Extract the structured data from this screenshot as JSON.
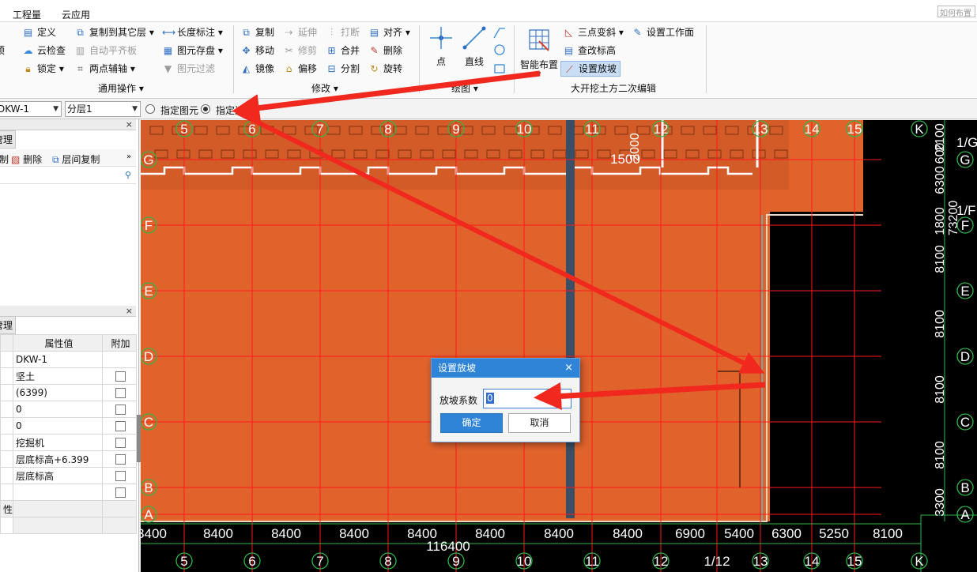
{
  "menu": {
    "items": [
      "工程量",
      "云应用"
    ],
    "help_placeholder": "如何布置"
  },
  "ribbon": {
    "common": {
      "items": [
        "定义",
        "云检查",
        "锁定",
        "复制到其它层",
        "自动平齐板",
        "两点辅轴",
        "长度标注",
        "图元存盘",
        "图元过滤"
      ],
      "group_label": "通用操作"
    },
    "modify": {
      "items": [
        "复制",
        "延伸",
        "打断",
        "对齐",
        "移动",
        "修剪",
        "合并",
        "删除",
        "镜像",
        "偏移",
        "分割",
        "旋转"
      ],
      "group_label": "修改"
    },
    "draw": {
      "items": [
        "点",
        "直线"
      ],
      "group_label": "绘图"
    },
    "pit": {
      "big_label": "智能布置",
      "items": [
        "三点变斜",
        "设置工作面",
        "查改标高",
        "设置放坡"
      ],
      "group_label": "大开挖土方二次编辑"
    },
    "left_cut": "顶"
  },
  "propbar": {
    "element": "DKW-1",
    "layer": "分层1",
    "radio1": "指定图元",
    "radio2": "指定边"
  },
  "left_panel": {
    "top_tab": "管理",
    "tools": [
      "删除",
      "层间复制"
    ],
    "prop_tab": "管理",
    "headers": [
      "属性值",
      "附加"
    ],
    "rows": [
      {
        "value": "DKW-1",
        "check": false
      },
      {
        "value": "坚土",
        "check": true
      },
      {
        "value": "(6399)",
        "check": true
      },
      {
        "value": "0",
        "check": true
      },
      {
        "value": "0",
        "check": true
      },
      {
        "value": "挖掘机",
        "check": true
      },
      {
        "value": "层底标高+6.399",
        "check": true
      },
      {
        "value": "层底标高",
        "check": true
      },
      {
        "value": "",
        "check": true
      },
      {
        "value": "",
        "check": false
      },
      {
        "value": "",
        "check": false
      }
    ],
    "attr_cut": "性"
  },
  "canvas": {
    "col_labels": [
      "5",
      "6",
      "7",
      "8",
      "9",
      "10",
      "11",
      "12",
      "13",
      "14",
      "15"
    ],
    "bottom_col_labels": [
      "5",
      "6",
      "7",
      "8",
      "9",
      "10",
      "11",
      "12",
      "1/12",
      "13",
      "14",
      "15"
    ],
    "row_labels": [
      "G",
      "F",
      "E",
      "D",
      "C",
      "B",
      "A"
    ],
    "right_row_labels": [
      "G",
      "F",
      "E",
      "D",
      "C",
      "B",
      "A"
    ],
    "corner_label": "K",
    "right_extra_labels": [
      "1/G",
      "1/F"
    ],
    "bottom_dims": [
      "8400",
      "8400",
      "8400",
      "8400",
      "8400",
      "8400",
      "8400",
      "8400",
      "6900",
      "5400",
      "6300",
      "5250",
      "8100"
    ],
    "bottom_dims_leftcut": "3400",
    "total_dim": "116400",
    "right_dims": [
      "2100",
      "600",
      "6300",
      "1800",
      "8100",
      "8100",
      "8100",
      "8100",
      "3300"
    ],
    "right_total": "73200",
    "top_dims": [
      "1500",
      "2000"
    ],
    "colors": {
      "pit": "#e0632c",
      "grid": "#ff1a1a",
      "axis": "#2fb64a",
      "bg": "#000000"
    }
  },
  "dialog": {
    "title": "设置放坡",
    "label": "放坡系数",
    "value": "0",
    "ok": "确定",
    "cancel": "取消"
  }
}
